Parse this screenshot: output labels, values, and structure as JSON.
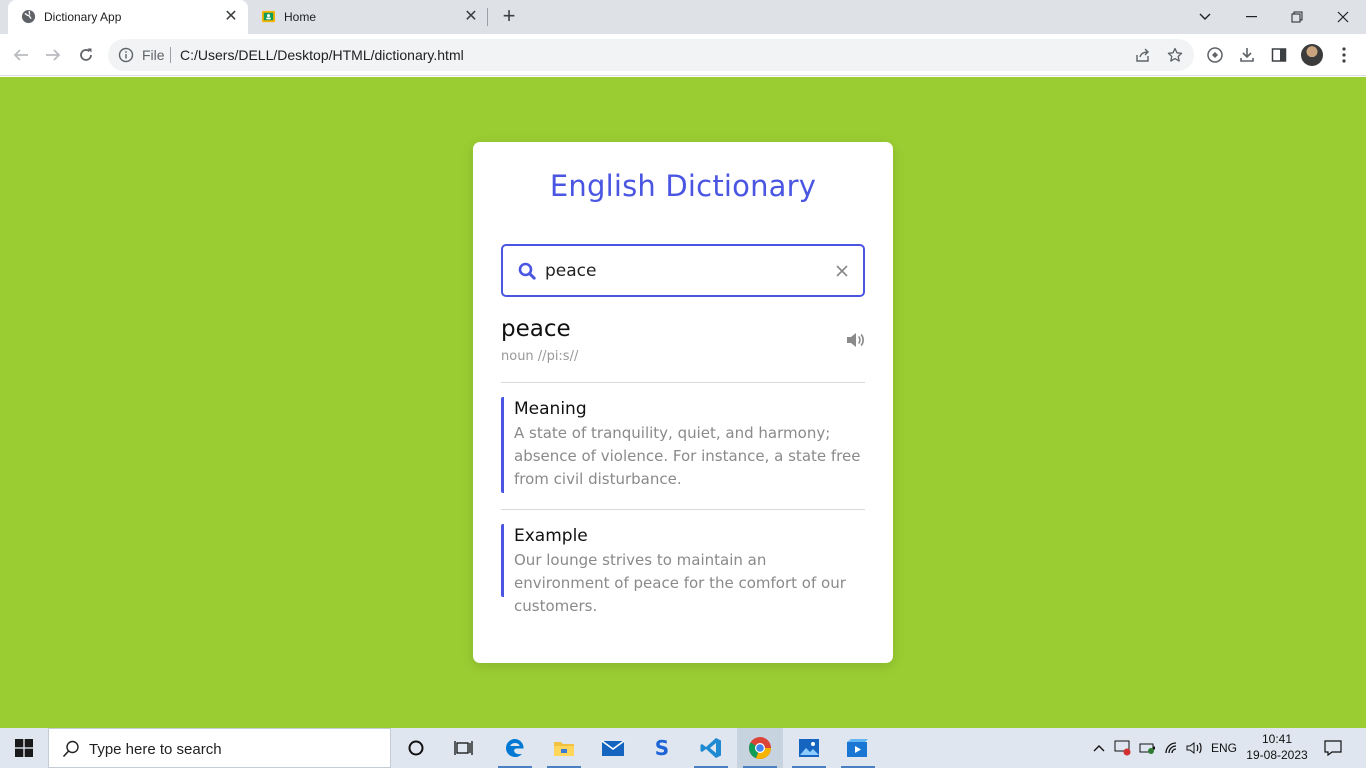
{
  "browser": {
    "tabs": [
      {
        "label": "Dictionary App",
        "active": true
      },
      {
        "label": "Home",
        "active": false
      }
    ],
    "address": {
      "scheme_label": "File",
      "url": "C:/Users/DELL/Desktop/HTML/dictionary.html"
    }
  },
  "app": {
    "title": "English Dictionary",
    "search": {
      "value": "peace",
      "placeholder": "Search a word"
    },
    "result": {
      "word": "peace",
      "phonetic": "noun //pi:s//",
      "meaning_heading": "Meaning",
      "meaning_text": "A state of tranquility, quiet, and harmony; absence of violence. For instance, a state free from civil disturbance.",
      "example_heading": "Example",
      "example_text": "Our lounge strives to maintain an environment of peace for the comfort of our customers."
    },
    "colors": {
      "background": "#9acd32",
      "accent": "#4a56e2"
    }
  },
  "taskbar": {
    "search_placeholder": "Type here to search",
    "language": "ENG",
    "time": "10:41",
    "date": "19-08-2023",
    "pinned_icons": [
      "cortana-icon",
      "task-view-icon",
      "edge-icon",
      "file-explorer-icon",
      "mail-icon",
      "skype-icon",
      "vscode-icon",
      "chrome-icon",
      "photos-icon",
      "video-editor-icon"
    ]
  }
}
